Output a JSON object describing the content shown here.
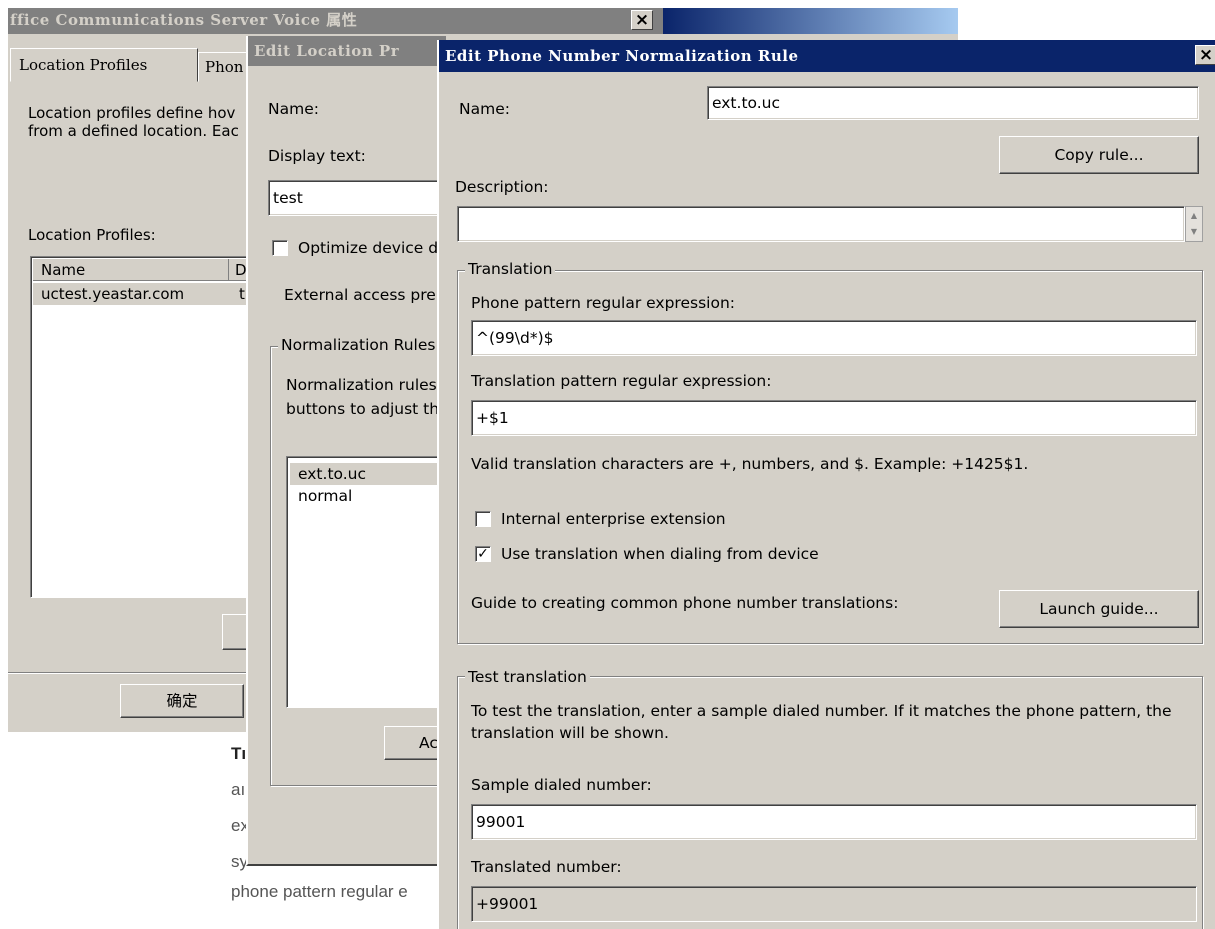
{
  "back_window": {
    "title": "ffice Communications Server Voice 属性",
    "close_label": "×",
    "tabs": [
      "Location Profiles",
      "Phon"
    ],
    "description_line1": "Location profiles define hov",
    "description_line2": "from a defined location. Eac",
    "profiles_label": "Location Profiles:",
    "columns": [
      "Name",
      "D"
    ],
    "rows": [
      {
        "name": "uctest.yeastar.com",
        "d": "t"
      }
    ],
    "ok_button": "确定"
  },
  "background_web": {
    "lines": [
      "Tı",
      "aı",
      "ex",
      "sy",
      "phone pattern regular e"
    ]
  },
  "middle_window": {
    "title": "Edit Location Pr",
    "name_label": "Name:",
    "display_text_label": "Display text:",
    "display_text_value": "test",
    "optimize_label": "Optimize device d",
    "external_label": "External access pre",
    "normalization_group": "Normalization Rules",
    "normalization_desc1": "Normalization rules",
    "normalization_desc2": "buttons to adjust th",
    "rules": [
      "ext.to.uc",
      "normal"
    ],
    "add_button": "Ac"
  },
  "front_window": {
    "title": "Edit Phone Number Normalization Rule",
    "close_label": "×",
    "name_label": "Name:",
    "name_value": "ext.to.uc",
    "copy_rule_button": "Copy rule...",
    "description_label": "Description:",
    "description_value": "",
    "translation_group": "Translation",
    "phone_pattern_label": "Phone pattern regular expression:",
    "phone_pattern_value": "^(99\\d*)$",
    "translation_pattern_label": "Translation pattern regular expression:",
    "translation_pattern_value": "+$1",
    "valid_chars_text": "Valid translation characters are +, numbers, and $. Example: +1425$1.",
    "internal_extension_label": "Internal enterprise extension",
    "internal_extension_checked": false,
    "use_translation_label": "Use translation when dialing from device",
    "use_translation_checked": true,
    "guide_text": "Guide to creating common phone number translations:",
    "launch_guide_button": "Launch guide...",
    "test_group": "Test translation",
    "test_desc_line1": "To test the translation, enter a sample dialed number. If it matches the phone pattern, the",
    "test_desc_line2": "translation will be shown.",
    "sample_label": "Sample dialed number:",
    "sample_value": "99001",
    "translated_label": "Translated number:",
    "translated_value": "+99001"
  },
  "colors": {
    "dialog_face": "#d4d0c8",
    "active_title": "#0a246a",
    "inactive_title": "#808080"
  }
}
